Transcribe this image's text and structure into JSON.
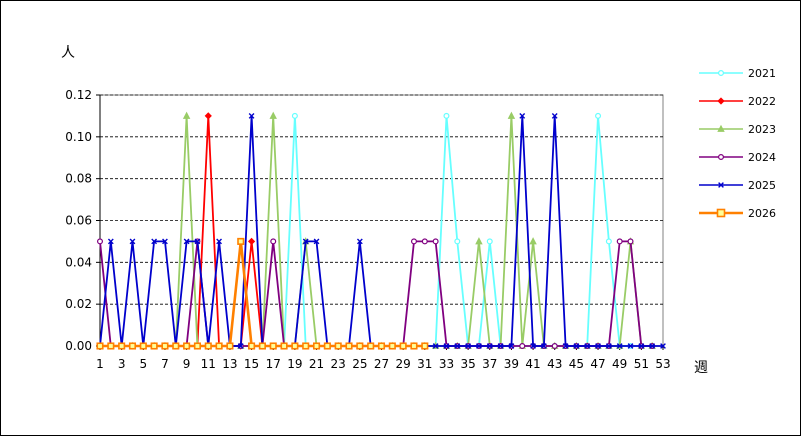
{
  "chart_data": {
    "type": "line",
    "ylabel": "人",
    "xlabel": "週",
    "ylim": [
      0,
      0.12
    ],
    "yticks": [
      "0.00",
      "0.02",
      "0.04",
      "0.06",
      "0.08",
      "0.10",
      "0.12"
    ],
    "xlim": [
      1,
      53
    ],
    "xticks": [
      "1",
      "3",
      "5",
      "7",
      "9",
      "11",
      "13",
      "15",
      "17",
      "19",
      "21",
      "23",
      "25",
      "27",
      "29",
      "31",
      "33",
      "35",
      "37",
      "39",
      "41",
      "43",
      "45",
      "47",
      "49",
      "51",
      "53"
    ],
    "grid": "horizontal-dashed",
    "legend_position": "right",
    "series": [
      {
        "name": "2021",
        "color": "#66ffff",
        "marker": "circle",
        "x": [
          1,
          2,
          3,
          4,
          5,
          6,
          7,
          8,
          9,
          10,
          11,
          12,
          13,
          14,
          15,
          16,
          17,
          18,
          19,
          20,
          21,
          22,
          23,
          24,
          25,
          26,
          27,
          28,
          29,
          30,
          31,
          32,
          33,
          34,
          35,
          36,
          37,
          38,
          39,
          40,
          41,
          42,
          43,
          44,
          45,
          46,
          47,
          48,
          49,
          50,
          51,
          52
        ],
        "values": [
          0,
          0,
          0,
          0,
          0,
          0,
          0,
          0,
          0,
          0,
          0,
          0,
          0,
          0,
          0,
          0,
          0,
          0,
          0.11,
          0,
          0,
          0,
          0,
          0,
          0,
          0,
          0,
          0,
          0,
          0,
          0,
          0,
          0.11,
          0.05,
          0,
          0,
          0.05,
          0,
          0,
          0,
          0,
          0,
          0,
          0,
          0,
          0,
          0.11,
          0.05,
          0,
          0,
          0,
          0
        ]
      },
      {
        "name": "2022",
        "color": "#ff0000",
        "marker": "diamond",
        "x": [
          1,
          2,
          3,
          4,
          5,
          6,
          7,
          8,
          9,
          10,
          11,
          12,
          13,
          14,
          15,
          16,
          17,
          18,
          19,
          20,
          21,
          22,
          23,
          24,
          25,
          26,
          27,
          28,
          29,
          30,
          31
        ],
        "values": [
          0,
          0,
          0,
          0,
          0,
          0,
          0,
          0,
          0,
          0,
          0.11,
          0,
          0,
          0,
          0.05,
          0,
          0,
          0,
          0,
          0,
          0,
          0,
          0,
          0,
          0,
          0,
          0,
          0,
          0,
          0,
          0
        ]
      },
      {
        "name": "2023",
        "color": "#99cc66",
        "marker": "triangle",
        "x": [
          1,
          2,
          3,
          4,
          5,
          6,
          7,
          8,
          9,
          10,
          11,
          12,
          13,
          14,
          15,
          16,
          17,
          18,
          19,
          20,
          21,
          22,
          23,
          24,
          25,
          26,
          27,
          28,
          29,
          30,
          31,
          32,
          33,
          34,
          35,
          36,
          37,
          38,
          39,
          40,
          41,
          42,
          43,
          44,
          45,
          46,
          47,
          48,
          49,
          50,
          51,
          52
        ],
        "values": [
          0,
          0,
          0,
          0,
          0,
          0,
          0,
          0,
          0.11,
          0,
          0,
          0,
          0,
          0,
          0,
          0,
          0.11,
          0,
          0,
          0.05,
          0,
          0,
          0,
          0,
          0,
          0,
          0,
          0,
          0,
          0,
          0,
          0,
          0,
          0,
          0,
          0.05,
          0,
          0,
          0.11,
          0,
          0.05,
          0,
          0,
          0,
          0,
          0,
          0,
          0,
          0,
          0.05,
          0,
          0
        ]
      },
      {
        "name": "2024",
        "color": "#800080",
        "marker": "circle-open",
        "x": [
          1,
          2,
          3,
          4,
          5,
          6,
          7,
          8,
          9,
          10,
          11,
          12,
          13,
          14,
          15,
          16,
          17,
          18,
          19,
          20,
          21,
          22,
          23,
          24,
          25,
          26,
          27,
          28,
          29,
          30,
          31,
          32,
          33,
          34,
          35,
          36,
          37,
          38,
          39,
          40,
          41,
          42,
          43,
          44,
          45,
          46,
          47,
          48,
          49,
          50,
          51,
          52
        ],
        "values": [
          0.05,
          0,
          0,
          0,
          0,
          0,
          0,
          0,
          0,
          0.05,
          0,
          0,
          0,
          0,
          0,
          0,
          0.05,
          0,
          0,
          0,
          0,
          0,
          0,
          0,
          0,
          0,
          0,
          0,
          0,
          0.05,
          0.05,
          0.05,
          0,
          0,
          0,
          0,
          0,
          0,
          0,
          0,
          0,
          0,
          0,
          0,
          0,
          0,
          0,
          0,
          0.05,
          0.05,
          0,
          0
        ]
      },
      {
        "name": "2025",
        "color": "#0000cc",
        "marker": "x",
        "x": [
          1,
          2,
          3,
          4,
          5,
          6,
          7,
          8,
          9,
          10,
          11,
          12,
          13,
          14,
          15,
          16,
          17,
          18,
          19,
          20,
          21,
          22,
          23,
          24,
          25,
          26,
          27,
          28,
          29,
          30,
          31,
          32,
          33,
          34,
          35,
          36,
          37,
          38,
          39,
          40,
          41,
          42,
          43,
          44,
          45,
          46,
          47,
          48,
          49,
          50,
          51,
          52,
          53
        ],
        "values": [
          0,
          0.05,
          0,
          0.05,
          0,
          0.05,
          0.05,
          0,
          0.05,
          0.05,
          0,
          0.05,
          0,
          0,
          0.11,
          0,
          0,
          0,
          0,
          0.05,
          0.05,
          0,
          0,
          0,
          0.05,
          0,
          0,
          0,
          0,
          0,
          0,
          0,
          0,
          0,
          0,
          0,
          0,
          0,
          0,
          0.11,
          0,
          0,
          0.11,
          0,
          0,
          0,
          0,
          0,
          0,
          0,
          0,
          0,
          0
        ]
      },
      {
        "name": "2026",
        "color": "#ff8000",
        "marker": "square",
        "x": [
          1,
          2,
          3,
          4,
          5,
          6,
          7,
          8,
          9,
          10,
          11,
          12,
          13,
          14,
          15,
          16,
          17,
          18,
          19,
          20,
          21,
          22,
          23,
          24,
          25,
          26,
          27,
          28,
          29,
          30,
          31
        ],
        "values": [
          0,
          0,
          0,
          0,
          0,
          0,
          0,
          0,
          0,
          0,
          0,
          0,
          0,
          0.05,
          0,
          0,
          0,
          0,
          0,
          0,
          0,
          0,
          0,
          0,
          0,
          0,
          0,
          0,
          0,
          0,
          0
        ]
      }
    ]
  }
}
